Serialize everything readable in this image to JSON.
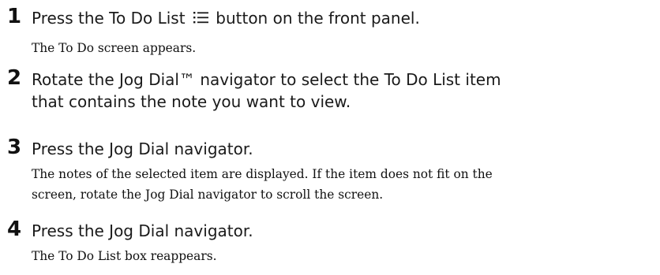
{
  "steps": [
    {
      "number": "1",
      "instruction_before_icon": "Press the To Do List ",
      "icon": "list-icon",
      "instruction_after_icon": " button on the front panel.",
      "result_lines": [
        "The To Do screen appears."
      ]
    },
    {
      "number": "2",
      "instruction_lines": [
        "Rotate the Jog Dial™ navigator to select the To Do List item",
        "that contains the note you want to view."
      ]
    },
    {
      "number": "3",
      "instruction_lines": [
        "Press the Jog Dial navigator."
      ],
      "result_lines": [
        "The notes of the selected item are displayed. If the item does not fit on the",
        "screen, rotate the Jog Dial navigator to scroll the screen."
      ]
    },
    {
      "number": "4",
      "instruction_lines": [
        "Press the Jog Dial navigator."
      ],
      "result_lines": [
        "The To Do List box reappears."
      ]
    }
  ]
}
